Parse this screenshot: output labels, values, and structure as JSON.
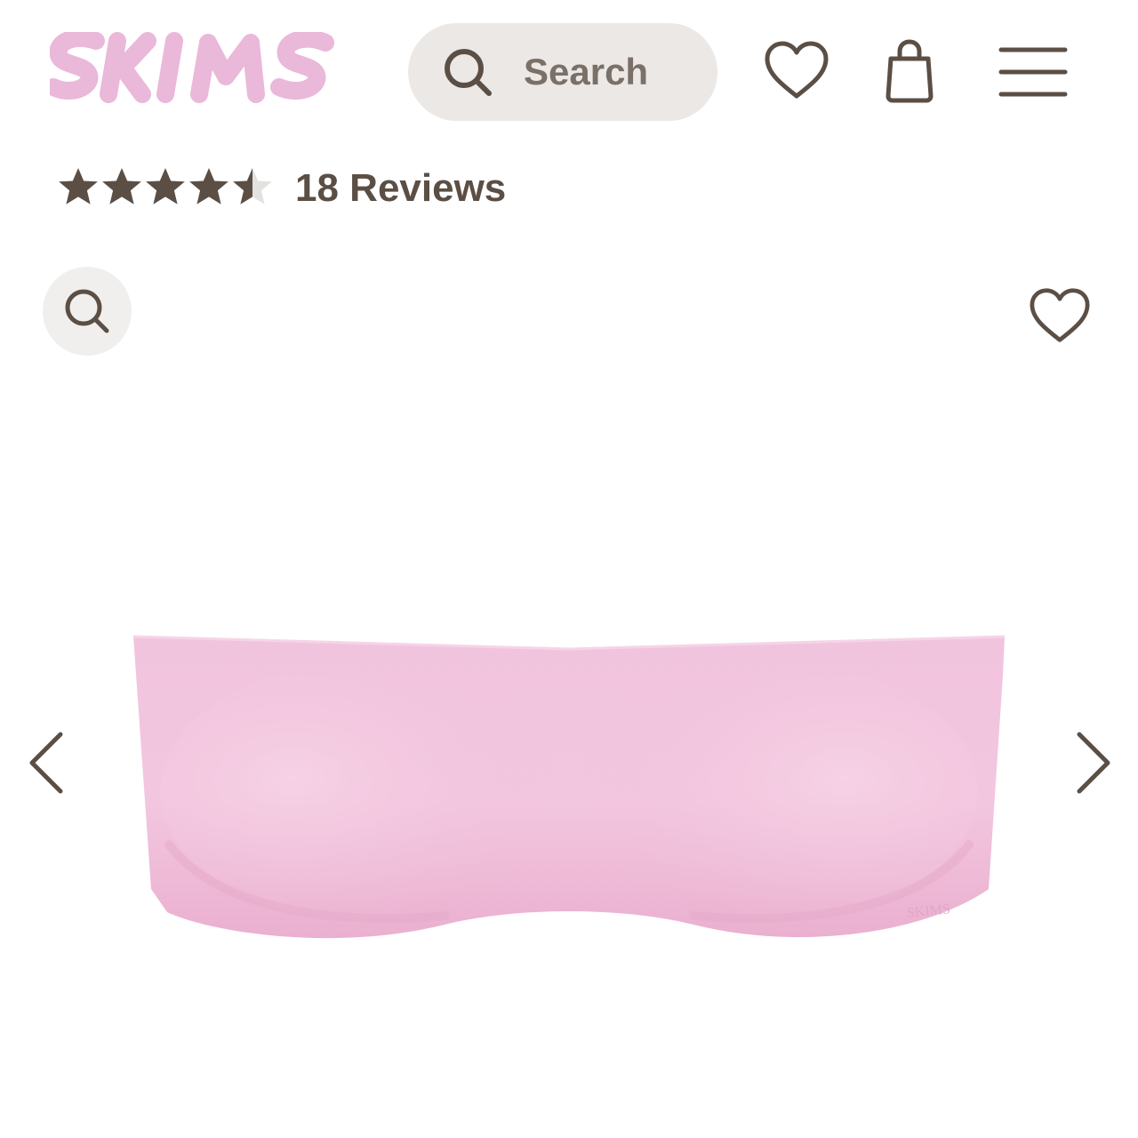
{
  "header": {
    "logo_text": "SKIMS",
    "search": {
      "placeholder": "Search"
    },
    "icons": {
      "search": "search-icon",
      "wishlist": "heart-icon",
      "bag": "shopping-bag-icon",
      "menu": "hamburger-menu-icon"
    }
  },
  "product": {
    "rating": {
      "value": 4.5,
      "max": 5
    },
    "reviews_label": "18 Reviews",
    "gallery": {
      "zoom_icon": "magnifier-icon",
      "favorite_icon": "heart-icon",
      "prev_icon": "chevron-left-icon",
      "next_icon": "chevron-right-icon",
      "image_alt": "Pink strapless bandeau bra"
    }
  },
  "colors": {
    "brand_pink": "#eab8d9",
    "icon_brown": "#5b4f45",
    "search_bg": "#ebe8e6",
    "product_pink": "#f0c2da",
    "star_empty": "#e4e2e0"
  }
}
